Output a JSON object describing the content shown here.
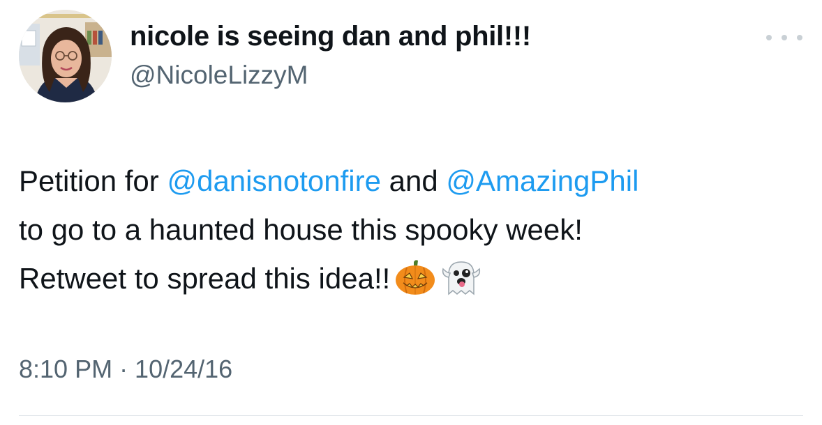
{
  "tweet": {
    "author": {
      "display_name": "nicole is seeing dan and phil!!!",
      "handle": "@NicoleLizzyM",
      "avatar": "profile-photo"
    },
    "more_icon": "ellipsis-icon",
    "body": {
      "line1_prefix": "Petition for ",
      "mention1": "@danisnotonfire",
      "line1_middle": " and ",
      "mention2": "@AmazingPhil",
      "line2": "to go to a haunted house this spooky week!",
      "line3": "Retweet to spread this idea!!",
      "emojis": [
        "jack-o-lantern-emoji",
        "ghost-emoji"
      ]
    },
    "timestamp": "8:10 PM · 10/24/16"
  },
  "colors": {
    "text": "#0f1419",
    "secondary": "#536471",
    "link": "#1d9bf0",
    "divider": "#e1e6ea"
  }
}
